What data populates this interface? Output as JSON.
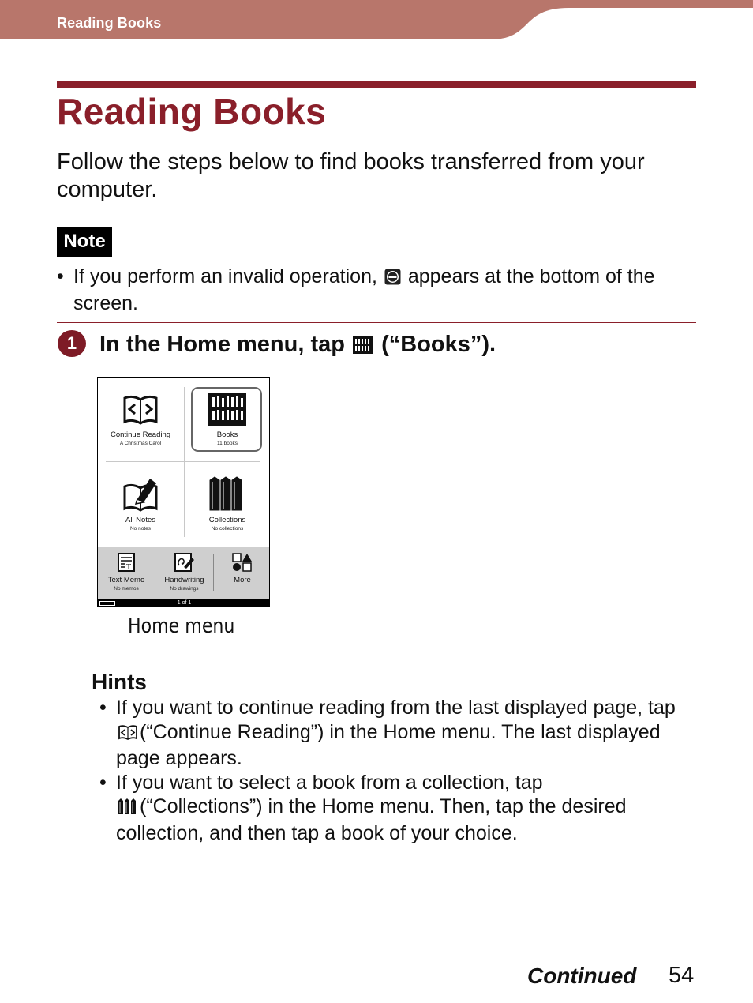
{
  "header": {
    "section_title": "Reading Books",
    "band_color": "#b8766b"
  },
  "page": {
    "title": "Reading Books",
    "accent_color": "#8a1f2a",
    "intro": "Follow the steps below to find books transferred from your computer."
  },
  "note": {
    "badge": "Note",
    "items": [
      {
        "before_icon": "If you perform an invalid operation,",
        "icon": "invalid-operation-icon",
        "after_icon": "appears at the bottom of the",
        "continuation": "screen."
      }
    ]
  },
  "step": {
    "number": "1",
    "before_icon": "In the Home menu, tap",
    "icon": "books-icon",
    "after_icon": "(“Books”)."
  },
  "device_screen": {
    "tiles": [
      {
        "label": "Continue Reading",
        "sub": "A Christmas Carol",
        "icon": "open-book-icon",
        "selected": false
      },
      {
        "label": "Books",
        "sub": "11 books",
        "icon": "bookshelf-icon",
        "selected": true
      },
      {
        "label": "All Notes",
        "sub": "No notes",
        "icon": "book-pen-icon",
        "selected": false
      },
      {
        "label": "Collections",
        "sub": "No collections",
        "icon": "collections-icon",
        "selected": false
      }
    ],
    "bottom_items": [
      {
        "label": "Text Memo",
        "sub": "No memos",
        "icon": "text-memo-icon"
      },
      {
        "label": "Handwriting",
        "sub": "No drawings",
        "icon": "handwriting-icon"
      },
      {
        "label": "More",
        "sub": "",
        "icon": "shapes-icon"
      }
    ],
    "status": {
      "page_indicator": "1 of 1",
      "battery_icon": "battery-icon"
    }
  },
  "caption": "Home menu",
  "hints": {
    "title": "Hints",
    "items": [
      {
        "line1": "If you want to continue reading from the last displayed page, tap",
        "icon": "continue-reading-icon",
        "line2": "(“Continue Reading”) in the Home menu. The last displayed",
        "line3": "page appears."
      },
      {
        "line1": "If you want to select a book from a collection, tap",
        "icon": "collections-icon",
        "line2": "(“Collections”) in the Home menu. Then, tap the desired",
        "line3": "collection, and then tap a book of your choice."
      }
    ]
  },
  "footer": {
    "continued": "Continued",
    "page_number": "54"
  }
}
